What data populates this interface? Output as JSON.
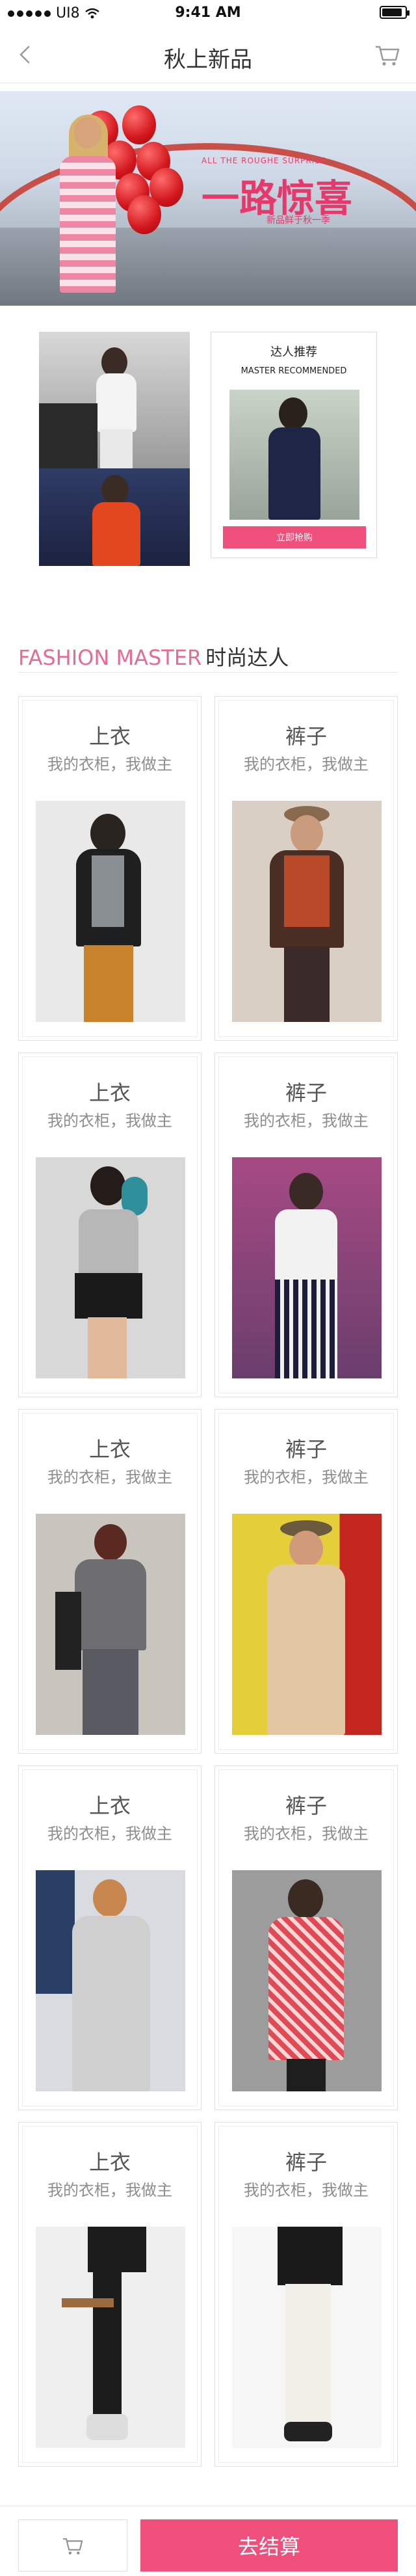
{
  "status_bar": {
    "carrier": "UI8",
    "time": "9:41 AM"
  },
  "nav": {
    "title": "秋上新品"
  },
  "hero": {
    "banner_small": "ALL THE ROUGHE SURPRISE",
    "banner_title": "一路惊喜",
    "banner_sub": "新品鲜于秋一季"
  },
  "feature": {
    "rec_title": "达人推荐",
    "rec_sub": "MASTER RECOMMENDED",
    "rec_button": "立即抢购"
  },
  "section": {
    "en": "FASHION MASTER",
    "cn": "时尚达人"
  },
  "products": [
    {
      "title": "上衣",
      "subtitle": "我的衣柜，我做主"
    },
    {
      "title": "裤子",
      "subtitle": "我的衣柜，我做主"
    },
    {
      "title": "上衣",
      "subtitle": "我的衣柜，我做主"
    },
    {
      "title": "裤子",
      "subtitle": "我的衣柜，我做主"
    },
    {
      "title": "上衣",
      "subtitle": "我的衣柜，我做主"
    },
    {
      "title": "裤子",
      "subtitle": "我的衣柜，我做主"
    },
    {
      "title": "上衣",
      "subtitle": "我的衣柜，我做主"
    },
    {
      "title": "裤子",
      "subtitle": "我的衣柜，我做主"
    },
    {
      "title": "上衣",
      "subtitle": "我的衣柜，我做主"
    },
    {
      "title": "裤子",
      "subtitle": "我的衣柜，我做主"
    }
  ],
  "bottom": {
    "checkout": "去结算"
  },
  "colors": {
    "accent": "#ef4f7b",
    "section_en": "#e86b93",
    "text": "#333333",
    "muted": "#8d8d8d"
  },
  "icons": {
    "back": "chevron-left-icon",
    "cart": "cart-icon",
    "wifi": "wifi-icon",
    "battery": "battery-icon"
  }
}
